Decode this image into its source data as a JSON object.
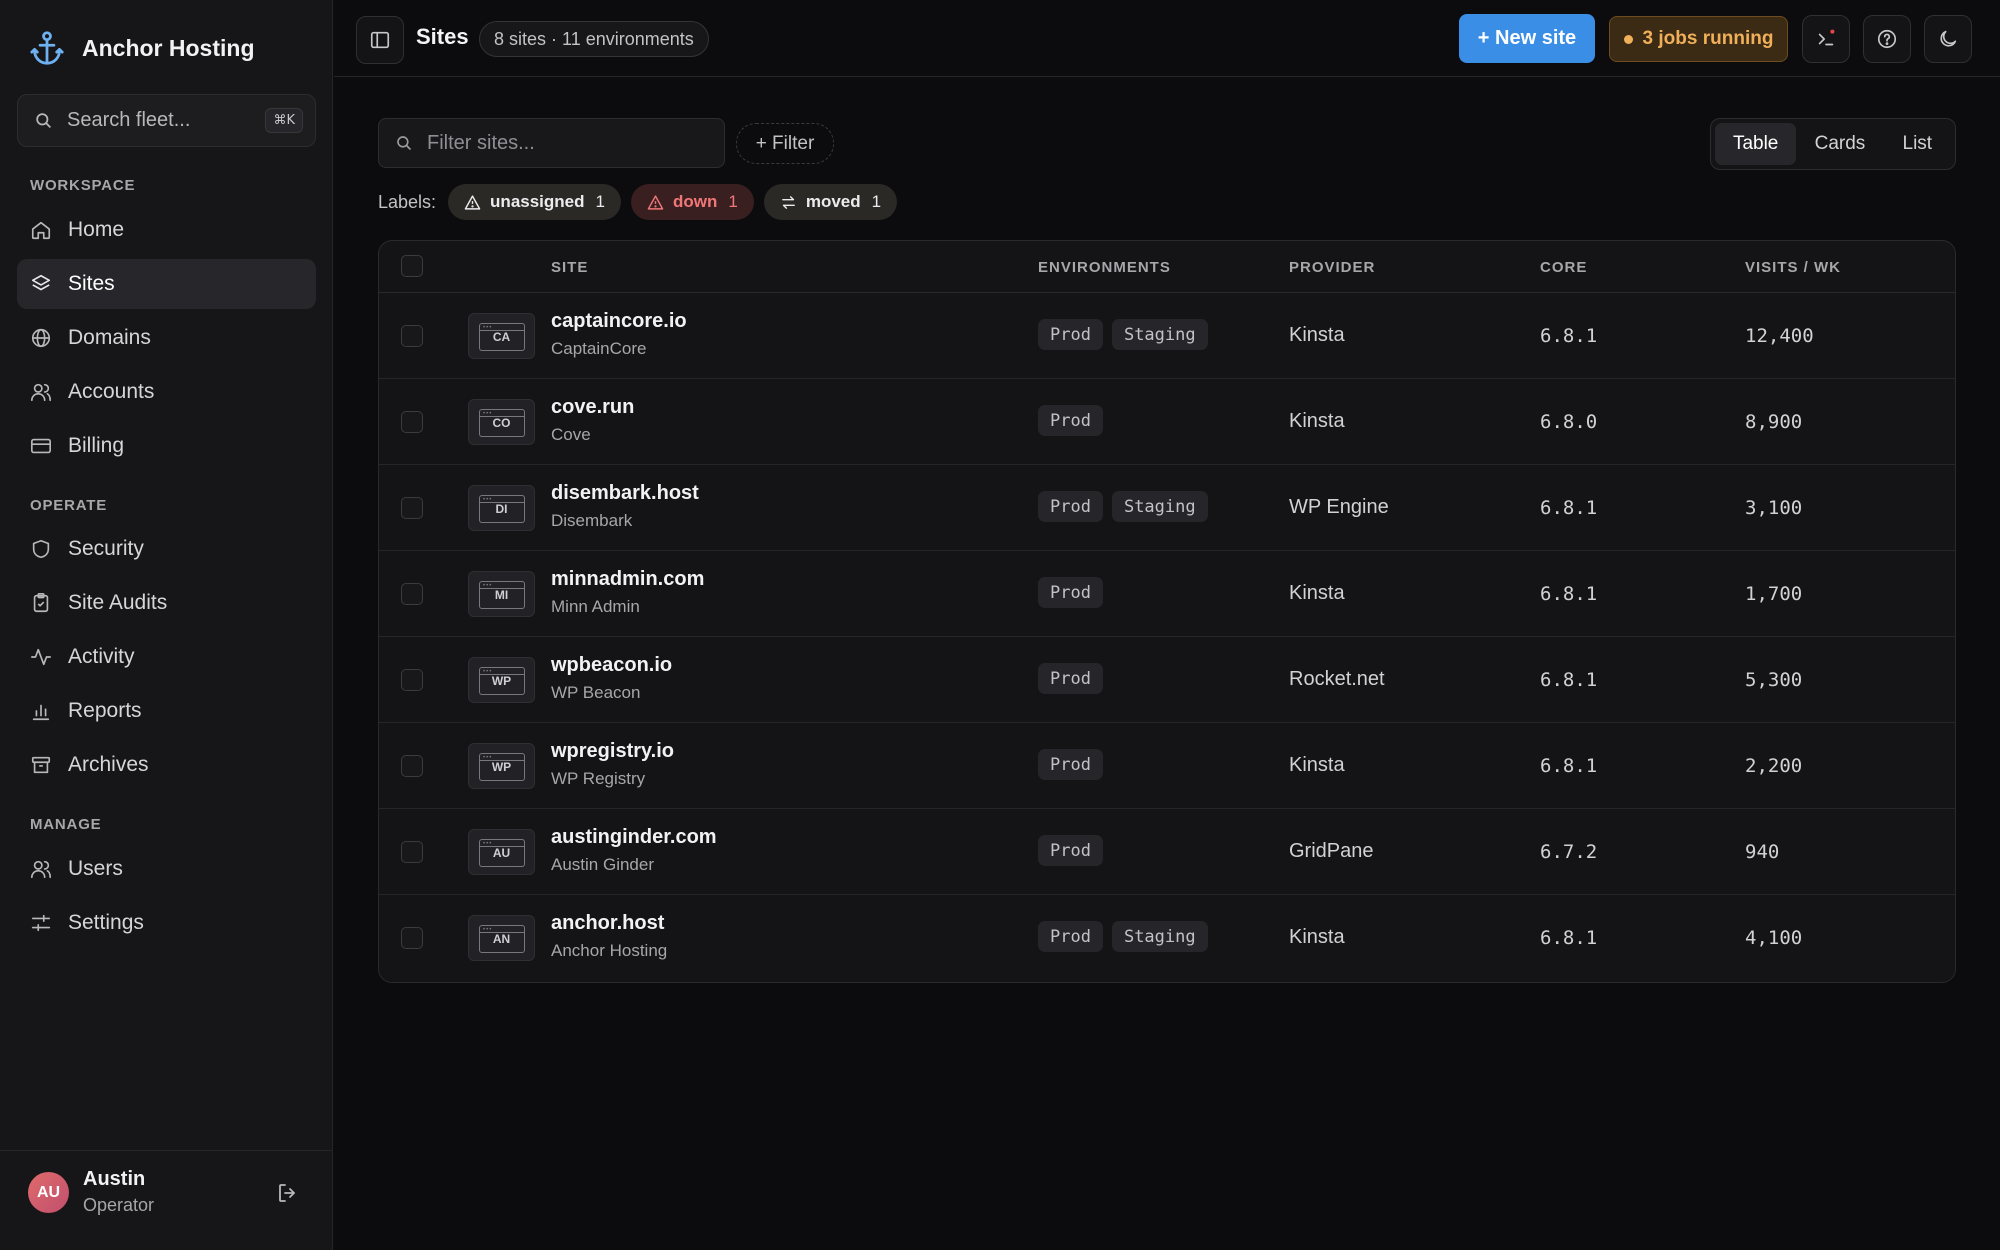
{
  "sidebar": {
    "brand": "Anchor Hosting",
    "search_placeholder": "Search fleet...",
    "search_shortcut": "⌘K",
    "sections": {
      "workspace": "WORKSPACE",
      "operate": "OPERATE",
      "manage": "MANAGE"
    },
    "items": [
      {
        "label": "Home",
        "icon": "home-icon",
        "active": false
      },
      {
        "label": "Sites",
        "icon": "layers-icon",
        "active": true
      },
      {
        "label": "Domains",
        "icon": "globe-icon",
        "active": false
      },
      {
        "label": "Accounts",
        "icon": "users-icon",
        "active": false
      },
      {
        "label": "Billing",
        "icon": "credit-card-icon",
        "active": false
      },
      {
        "label": "Security",
        "icon": "shield-icon",
        "active": false
      },
      {
        "label": "Site Audits",
        "icon": "clipboard-check-icon",
        "active": false
      },
      {
        "label": "Activity",
        "icon": "activity-icon",
        "active": false
      },
      {
        "label": "Reports",
        "icon": "bar-chart-icon",
        "active": false
      },
      {
        "label": "Archives",
        "icon": "archive-icon",
        "active": false
      },
      {
        "label": "Users",
        "icon": "users-icon",
        "active": false
      },
      {
        "label": "Settings",
        "icon": "sliders-icon",
        "active": false
      }
    ],
    "user": {
      "initials": "AU",
      "name": "Austin",
      "role": "Operator"
    }
  },
  "topbar": {
    "title": "Sites",
    "count": "8 sites · 11 environments",
    "new_site": "+ New site",
    "jobs": "3 jobs running"
  },
  "toolbar": {
    "filter_placeholder": "Filter sites...",
    "add_filter": "+ Filter",
    "views": [
      "Table",
      "Cards",
      "List"
    ],
    "active_view": "Table",
    "labels_title": "Labels:",
    "labels": [
      {
        "name": "unassigned",
        "count": "1",
        "icon": "warning-icon",
        "tone": "neutral"
      },
      {
        "name": "down",
        "count": "1",
        "icon": "warning-icon",
        "tone": "red"
      },
      {
        "name": "moved",
        "count": "1",
        "icon": "arrows-swap-icon",
        "tone": "neutral"
      }
    ]
  },
  "table": {
    "columns": {
      "site": "SITE",
      "environments": "ENVIRONMENTS",
      "provider": "PROVIDER",
      "core": "CORE",
      "visits": "VISITS / WK"
    },
    "rows": [
      {
        "abbr": "CA",
        "domain": "captaincore.io",
        "name": "CaptainCore",
        "envs": [
          "Prod",
          "Staging"
        ],
        "provider": "Kinsta",
        "core": "6.8.1",
        "visits": "12,400"
      },
      {
        "abbr": "CO",
        "domain": "cove.run",
        "name": "Cove",
        "envs": [
          "Prod"
        ],
        "provider": "Kinsta",
        "core": "6.8.0",
        "visits": "8,900"
      },
      {
        "abbr": "DI",
        "domain": "disembark.host",
        "name": "Disembark",
        "envs": [
          "Prod",
          "Staging"
        ],
        "provider": "WP Engine",
        "core": "6.8.1",
        "visits": "3,100"
      },
      {
        "abbr": "MI",
        "domain": "minnadmin.com",
        "name": "Minn Admin",
        "envs": [
          "Prod"
        ],
        "provider": "Kinsta",
        "core": "6.8.1",
        "visits": "1,700"
      },
      {
        "abbr": "WP",
        "domain": "wpbeacon.io",
        "name": "WP Beacon",
        "envs": [
          "Prod"
        ],
        "provider": "Rocket.net",
        "core": "6.8.1",
        "visits": "5,300"
      },
      {
        "abbr": "WP",
        "domain": "wpregistry.io",
        "name": "WP Registry",
        "envs": [
          "Prod"
        ],
        "provider": "Kinsta",
        "core": "6.8.1",
        "visits": "2,200"
      },
      {
        "abbr": "AU",
        "domain": "austinginder.com",
        "name": "Austin Ginder",
        "envs": [
          "Prod"
        ],
        "provider": "GridPane",
        "core": "6.7.2",
        "visits": "940"
      },
      {
        "abbr": "AN",
        "domain": "anchor.host",
        "name": "Anchor Hosting",
        "envs": [
          "Prod",
          "Staging"
        ],
        "provider": "Kinsta",
        "core": "6.8.1",
        "visits": "4,100"
      }
    ]
  },
  "colors": {
    "accent": "#3a8ee6",
    "jobs": "#f0b05a",
    "danger": "#f07777",
    "background": "#0c0c0e",
    "sidebar": "#161618"
  }
}
